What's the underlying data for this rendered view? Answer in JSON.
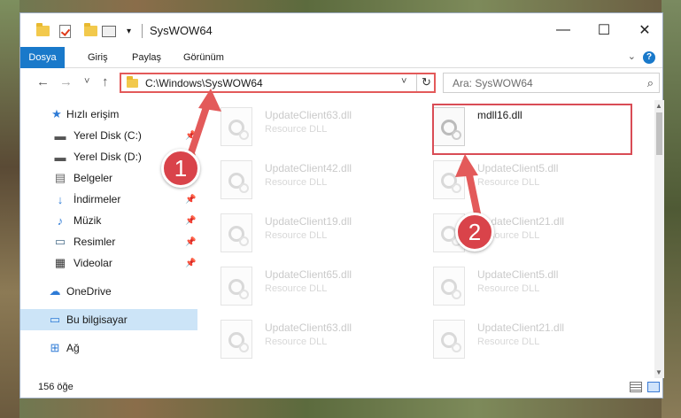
{
  "window": {
    "title": "SysWOW64"
  },
  "ribbon": {
    "tabs": [
      {
        "label": "Dosya"
      },
      {
        "label": "Giriş"
      },
      {
        "label": "Paylaş"
      },
      {
        "label": "Görünüm"
      }
    ],
    "help_label": "?"
  },
  "navigation": {
    "back": "←",
    "forward": "→",
    "recent": "˅",
    "up": "↑",
    "address": "C:\\Windows\\SysWOW64",
    "dropdown": "˅",
    "refresh": "↻"
  },
  "search": {
    "placeholder": "Ara: SysWOW64"
  },
  "sidebar": {
    "items": [
      {
        "label": "Hızlı erişim",
        "icon": "star-icon"
      },
      {
        "label": "Yerel Disk (C:)",
        "icon": "drive-icon",
        "pinned": true
      },
      {
        "label": "Yerel Disk (D:)",
        "icon": "drive-icon",
        "pinned": true
      },
      {
        "label": "Belgeler",
        "icon": "document-icon",
        "pinned": true
      },
      {
        "label": "İndirmeler",
        "icon": "download-icon",
        "pinned": true
      },
      {
        "label": "Müzik",
        "icon": "music-icon",
        "pinned": true
      },
      {
        "label": "Resimler",
        "icon": "pictures-icon",
        "pinned": true
      },
      {
        "label": "Videolar",
        "icon": "video-icon",
        "pinned": true
      },
      {
        "label": "OneDrive",
        "icon": "cloud-icon"
      },
      {
        "label": "Bu bilgisayar",
        "icon": "computer-icon",
        "selected": true
      },
      {
        "label": "Ağ",
        "icon": "network-icon"
      }
    ]
  },
  "files": {
    "left_column": [
      {
        "name": "UpdateClient63.dll",
        "type": "Resource DLL"
      },
      {
        "name": "UpdateClient42.dll",
        "type": "Resource DLL"
      },
      {
        "name": "UpdateClient19.dll",
        "type": "Resource DLL"
      },
      {
        "name": "UpdateClient65.dll",
        "type": "Resource DLL"
      },
      {
        "name": "UpdateClient63.dll",
        "type": "Resource DLL"
      }
    ],
    "right_column": [
      {
        "name": "mdll16.dll",
        "type": "",
        "highlighted": true
      },
      {
        "name": "UpdateClient5.dll",
        "type": "Resource DLL"
      },
      {
        "name": "UpdateClient21.dll",
        "type": "Resource DLL"
      },
      {
        "name": "UpdateClient5.dll",
        "type": "Resource DLL"
      },
      {
        "name": "UpdateClient21.dll",
        "type": "Resource DLL"
      }
    ]
  },
  "status": {
    "item_count": "156 öğe"
  },
  "annotations": {
    "step1": "1",
    "step2": "2",
    "color": "#d9434a"
  },
  "colors": {
    "accent": "#1979ca",
    "selection": "#cce4f7",
    "highlight_border": "#e35a5a"
  }
}
